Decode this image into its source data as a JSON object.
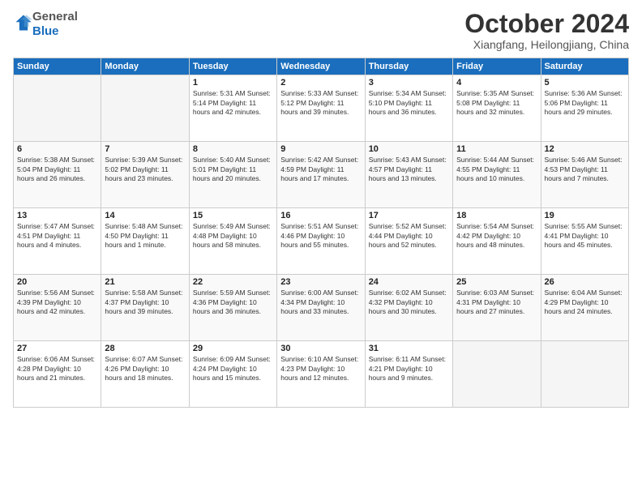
{
  "logo": {
    "general": "General",
    "blue": "Blue"
  },
  "title": "October 2024",
  "location": "Xiangfang, Heilongjiang, China",
  "days_of_week": [
    "Sunday",
    "Monday",
    "Tuesday",
    "Wednesday",
    "Thursday",
    "Friday",
    "Saturday"
  ],
  "weeks": [
    [
      {
        "day": "",
        "info": ""
      },
      {
        "day": "",
        "info": ""
      },
      {
        "day": "1",
        "info": "Sunrise: 5:31 AM\nSunset: 5:14 PM\nDaylight: 11 hours and 42 minutes."
      },
      {
        "day": "2",
        "info": "Sunrise: 5:33 AM\nSunset: 5:12 PM\nDaylight: 11 hours and 39 minutes."
      },
      {
        "day": "3",
        "info": "Sunrise: 5:34 AM\nSunset: 5:10 PM\nDaylight: 11 hours and 36 minutes."
      },
      {
        "day": "4",
        "info": "Sunrise: 5:35 AM\nSunset: 5:08 PM\nDaylight: 11 hours and 32 minutes."
      },
      {
        "day": "5",
        "info": "Sunrise: 5:36 AM\nSunset: 5:06 PM\nDaylight: 11 hours and 29 minutes."
      }
    ],
    [
      {
        "day": "6",
        "info": "Sunrise: 5:38 AM\nSunset: 5:04 PM\nDaylight: 11 hours and 26 minutes."
      },
      {
        "day": "7",
        "info": "Sunrise: 5:39 AM\nSunset: 5:02 PM\nDaylight: 11 hours and 23 minutes."
      },
      {
        "day": "8",
        "info": "Sunrise: 5:40 AM\nSunset: 5:01 PM\nDaylight: 11 hours and 20 minutes."
      },
      {
        "day": "9",
        "info": "Sunrise: 5:42 AM\nSunset: 4:59 PM\nDaylight: 11 hours and 17 minutes."
      },
      {
        "day": "10",
        "info": "Sunrise: 5:43 AM\nSunset: 4:57 PM\nDaylight: 11 hours and 13 minutes."
      },
      {
        "day": "11",
        "info": "Sunrise: 5:44 AM\nSunset: 4:55 PM\nDaylight: 11 hours and 10 minutes."
      },
      {
        "day": "12",
        "info": "Sunrise: 5:46 AM\nSunset: 4:53 PM\nDaylight: 11 hours and 7 minutes."
      }
    ],
    [
      {
        "day": "13",
        "info": "Sunrise: 5:47 AM\nSunset: 4:51 PM\nDaylight: 11 hours and 4 minutes."
      },
      {
        "day": "14",
        "info": "Sunrise: 5:48 AM\nSunset: 4:50 PM\nDaylight: 11 hours and 1 minute."
      },
      {
        "day": "15",
        "info": "Sunrise: 5:49 AM\nSunset: 4:48 PM\nDaylight: 10 hours and 58 minutes."
      },
      {
        "day": "16",
        "info": "Sunrise: 5:51 AM\nSunset: 4:46 PM\nDaylight: 10 hours and 55 minutes."
      },
      {
        "day": "17",
        "info": "Sunrise: 5:52 AM\nSunset: 4:44 PM\nDaylight: 10 hours and 52 minutes."
      },
      {
        "day": "18",
        "info": "Sunrise: 5:54 AM\nSunset: 4:42 PM\nDaylight: 10 hours and 48 minutes."
      },
      {
        "day": "19",
        "info": "Sunrise: 5:55 AM\nSunset: 4:41 PM\nDaylight: 10 hours and 45 minutes."
      }
    ],
    [
      {
        "day": "20",
        "info": "Sunrise: 5:56 AM\nSunset: 4:39 PM\nDaylight: 10 hours and 42 minutes."
      },
      {
        "day": "21",
        "info": "Sunrise: 5:58 AM\nSunset: 4:37 PM\nDaylight: 10 hours and 39 minutes."
      },
      {
        "day": "22",
        "info": "Sunrise: 5:59 AM\nSunset: 4:36 PM\nDaylight: 10 hours and 36 minutes."
      },
      {
        "day": "23",
        "info": "Sunrise: 6:00 AM\nSunset: 4:34 PM\nDaylight: 10 hours and 33 minutes."
      },
      {
        "day": "24",
        "info": "Sunrise: 6:02 AM\nSunset: 4:32 PM\nDaylight: 10 hours and 30 minutes."
      },
      {
        "day": "25",
        "info": "Sunrise: 6:03 AM\nSunset: 4:31 PM\nDaylight: 10 hours and 27 minutes."
      },
      {
        "day": "26",
        "info": "Sunrise: 6:04 AM\nSunset: 4:29 PM\nDaylight: 10 hours and 24 minutes."
      }
    ],
    [
      {
        "day": "27",
        "info": "Sunrise: 6:06 AM\nSunset: 4:28 PM\nDaylight: 10 hours and 21 minutes."
      },
      {
        "day": "28",
        "info": "Sunrise: 6:07 AM\nSunset: 4:26 PM\nDaylight: 10 hours and 18 minutes."
      },
      {
        "day": "29",
        "info": "Sunrise: 6:09 AM\nSunset: 4:24 PM\nDaylight: 10 hours and 15 minutes."
      },
      {
        "day": "30",
        "info": "Sunrise: 6:10 AM\nSunset: 4:23 PM\nDaylight: 10 hours and 12 minutes."
      },
      {
        "day": "31",
        "info": "Sunrise: 6:11 AM\nSunset: 4:21 PM\nDaylight: 10 hours and 9 minutes."
      },
      {
        "day": "",
        "info": ""
      },
      {
        "day": "",
        "info": ""
      }
    ]
  ]
}
